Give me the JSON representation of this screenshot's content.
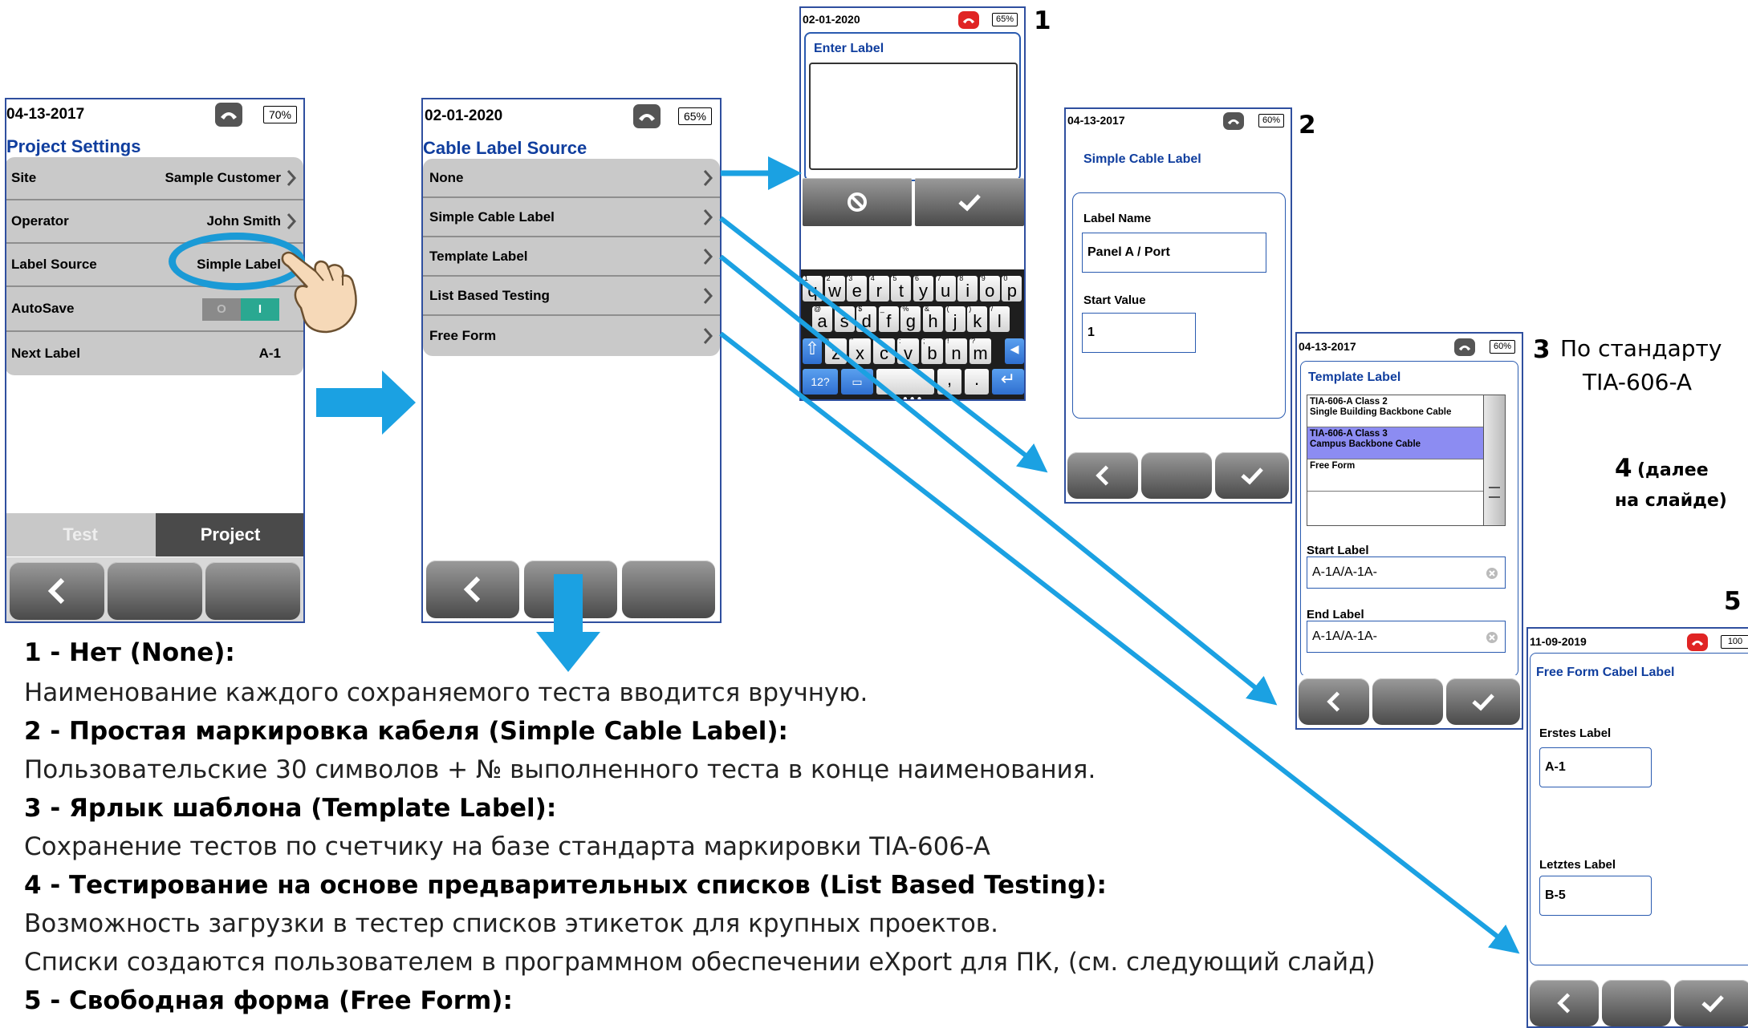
{
  "screen1": {
    "date": "04-13-2017",
    "battery": "70%",
    "title": "Project Settings",
    "rows": [
      {
        "label": "Site",
        "value": "Sample Customer"
      },
      {
        "label": "Operator",
        "value": "John Smith"
      },
      {
        "label": "Label Source",
        "value": "Simple Label"
      },
      {
        "label": "AutoSave",
        "toggle_off": "O",
        "toggle_on": "I"
      },
      {
        "label": "Next Label",
        "value": "A-1"
      }
    ],
    "tabs": [
      "Test",
      "Project"
    ]
  },
  "screen2": {
    "date": "02-01-2020",
    "battery": "65%",
    "title": "Cable Label Source",
    "items": [
      "None",
      "Simple Cable Label",
      "Template Label",
      "List Based Testing",
      "Free Form"
    ]
  },
  "screen_enter": {
    "date": "02-01-2020",
    "battery": "65%",
    "title": "Enter Label",
    "keyboard": {
      "row1": [
        [
          "q",
          "1"
        ],
        [
          "w",
          "2"
        ],
        [
          "e",
          "3"
        ],
        [
          "r",
          "4"
        ],
        [
          "t",
          "5"
        ],
        [
          "y",
          "6"
        ],
        [
          "u",
          "7"
        ],
        [
          "i",
          "8"
        ],
        [
          "o",
          "9"
        ],
        [
          "p",
          "0"
        ]
      ],
      "row2": [
        [
          "a",
          "@"
        ],
        [
          "s",
          "#"
        ],
        [
          "d",
          "$"
        ],
        [
          "f",
          "_"
        ],
        [
          "g",
          "%"
        ],
        [
          "h",
          "&"
        ],
        [
          "j",
          "("
        ],
        [
          "k",
          ")"
        ],
        [
          "l",
          "/"
        ]
      ],
      "row3": [
        [
          "z",
          "*"
        ],
        [
          "x",
          "\""
        ],
        [
          "c",
          "'"
        ],
        [
          "v",
          ":"
        ],
        [
          "b",
          ";"
        ],
        [
          "n",
          "!"
        ],
        [
          "m",
          "?"
        ]
      ],
      "numkey": "12?",
      "comma": ",",
      "period": "."
    }
  },
  "screen_simple": {
    "date": "04-13-2017",
    "battery": "60%",
    "title": "Simple Cable Label",
    "label_name_caption": "Label Name",
    "label_name_value": "Panel A / Port",
    "start_value_caption": "Start Value",
    "start_value": "1"
  },
  "screen_template": {
    "date": "04-13-2017",
    "battery": "60%",
    "title": "Template Label",
    "list": [
      {
        "line1": "TIA-606-A Class 2",
        "line2": "Single Building Backbone Cable",
        "selected": false
      },
      {
        "line1": "TIA-606-A Class 3",
        "line2": "Campus Backbone Cable",
        "selected": true
      },
      {
        "line1": "Free Form",
        "line2": "",
        "selected": false
      }
    ],
    "start_caption": "Start Label",
    "start_value": "A-1A/A-1A-",
    "end_caption": "End Label",
    "end_value": "A-1A/A-1A-"
  },
  "screen_free": {
    "date": "11-09-2019",
    "battery": "100",
    "title": "Free Form Cabel Label",
    "first_caption": "Erstes Label",
    "first_value": "A-1",
    "last_caption": "Letztes Label",
    "last_value": "B-5"
  },
  "callouts": {
    "n1": "1",
    "n2": "2",
    "n3": "3",
    "n3_text_a": "По стандарту",
    "n3_text_b": "TIA-606-A",
    "n4": "4",
    "n4_text_a": "(далее",
    "n4_text_b": "на слайде)",
    "n5": "5"
  },
  "text": {
    "h1": "1 - Нет (None):",
    "p1": "Наименование каждого сохраняемого теста вводится вручную.",
    "h2": "2 - Простая маркировка кабеля (Simple Cable Label):",
    "p2": "Пользовательские 30 символов + № выполненного теста в конце наименования.",
    "h3": "3 - Ярлык шаблона (Template Label):",
    "p3": "Сохранение тестов по счетчику на базе стандарта маркировки TIA-606-A",
    "h4": "4 - Тестирование на основе предварительных списков (List Based Testing):",
    "p4a": "Возможность загрузки в тестер списков этикеток для крупных проектов.",
    "p4b": "Списки создаются пользователем в программном обеспечении eXport для ПК, (см. следующий слайд)",
    "h5": "5 - Свободная форма (Free Form):"
  },
  "colors": {
    "arrow": "#1ba1e2",
    "title_blue": "#103e9e",
    "highlight": "#1a9ad6"
  }
}
